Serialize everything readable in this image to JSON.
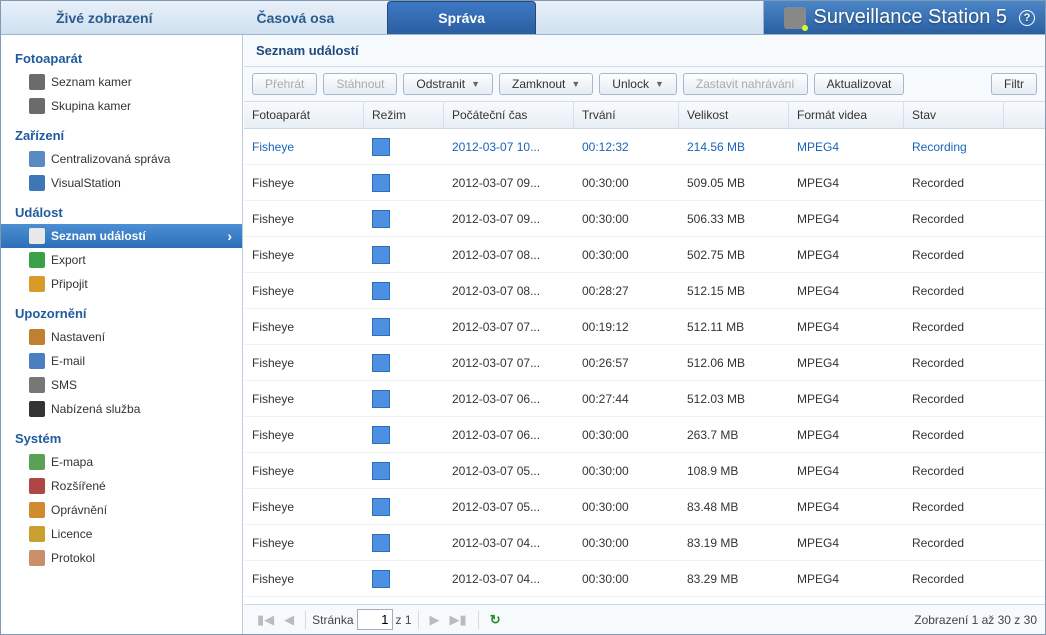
{
  "brand": {
    "title": "Surveillance Station 5"
  },
  "tabs": [
    {
      "label": "Živé zobrazení",
      "active": false
    },
    {
      "label": "Časová osa",
      "active": false
    },
    {
      "label": "Správa",
      "active": true
    }
  ],
  "sidebar": {
    "groups": [
      {
        "title": "Fotoaparát",
        "items": [
          {
            "label": "Seznam kamer",
            "icon": "#6b6b6b",
            "name": "cam-list"
          },
          {
            "label": "Skupina kamer",
            "icon": "#6b6b6b",
            "name": "cam-group"
          }
        ]
      },
      {
        "title": "Zařízení",
        "items": [
          {
            "label": "Centralizovaná správa",
            "icon": "#5a8bc0",
            "name": "central-mgmt"
          },
          {
            "label": "VisualStation",
            "icon": "#3d77b5",
            "name": "visualstation"
          }
        ]
      },
      {
        "title": "Událost",
        "items": [
          {
            "label": "Seznam událostí",
            "icon": "#e8e8e8",
            "name": "event-list",
            "active": true
          },
          {
            "label": "Export",
            "icon": "#3aa04a",
            "name": "export"
          },
          {
            "label": "Připojit",
            "icon": "#d79a2b",
            "name": "attach"
          }
        ]
      },
      {
        "title": "Upozornění",
        "items": [
          {
            "label": "Nastavení",
            "icon": "#c08030",
            "name": "notif-settings"
          },
          {
            "label": "E-mail",
            "icon": "#4a80c0",
            "name": "email"
          },
          {
            "label": "SMS",
            "icon": "#777",
            "name": "sms"
          },
          {
            "label": "Nabízená služba",
            "icon": "#333",
            "name": "push"
          }
        ]
      },
      {
        "title": "Systém",
        "items": [
          {
            "label": "E-mapa",
            "icon": "#5aa055",
            "name": "emap"
          },
          {
            "label": "Rozšířené",
            "icon": "#b04545",
            "name": "advanced"
          },
          {
            "label": "Oprávnění",
            "icon": "#d28a30",
            "name": "privilege"
          },
          {
            "label": "Licence",
            "icon": "#c9a030",
            "name": "license"
          },
          {
            "label": "Protokol",
            "icon": "#c98f6a",
            "name": "log"
          }
        ]
      }
    ]
  },
  "panel": {
    "title": "Seznam událostí"
  },
  "toolbar": {
    "play": "Přehrát",
    "download": "Stáhnout",
    "remove": "Odstranit",
    "lock": "Zamknout",
    "unlock": "Unlock",
    "stoprec": "Zastavit nahrávání",
    "update": "Aktualizovat",
    "filter": "Filtr"
  },
  "columns": {
    "camera": "Fotoaparát",
    "mode": "Režim",
    "start": "Počáteční čas",
    "duration": "Trvání",
    "size": "Velikost",
    "format": "Formát videa",
    "status": "Stav"
  },
  "rows": [
    {
      "camera": "Fisheye",
      "start": "2012-03-07 10...",
      "duration": "00:12:32",
      "size": "214.56 MB",
      "format": "MPEG4",
      "status": "Recording",
      "selected": true
    },
    {
      "camera": "Fisheye",
      "start": "2012-03-07 09...",
      "duration": "00:30:00",
      "size": "509.05 MB",
      "format": "MPEG4",
      "status": "Recorded"
    },
    {
      "camera": "Fisheye",
      "start": "2012-03-07 09...",
      "duration": "00:30:00",
      "size": "506.33 MB",
      "format": "MPEG4",
      "status": "Recorded"
    },
    {
      "camera": "Fisheye",
      "start": "2012-03-07 08...",
      "duration": "00:30:00",
      "size": "502.75 MB",
      "format": "MPEG4",
      "status": "Recorded"
    },
    {
      "camera": "Fisheye",
      "start": "2012-03-07 08...",
      "duration": "00:28:27",
      "size": "512.15 MB",
      "format": "MPEG4",
      "status": "Recorded"
    },
    {
      "camera": "Fisheye",
      "start": "2012-03-07 07...",
      "duration": "00:19:12",
      "size": "512.11 MB",
      "format": "MPEG4",
      "status": "Recorded"
    },
    {
      "camera": "Fisheye",
      "start": "2012-03-07 07...",
      "duration": "00:26:57",
      "size": "512.06 MB",
      "format": "MPEG4",
      "status": "Recorded"
    },
    {
      "camera": "Fisheye",
      "start": "2012-03-07 06...",
      "duration": "00:27:44",
      "size": "512.03 MB",
      "format": "MPEG4",
      "status": "Recorded"
    },
    {
      "camera": "Fisheye",
      "start": "2012-03-07 06...",
      "duration": "00:30:00",
      "size": "263.7 MB",
      "format": "MPEG4",
      "status": "Recorded"
    },
    {
      "camera": "Fisheye",
      "start": "2012-03-07 05...",
      "duration": "00:30:00",
      "size": "108.9 MB",
      "format": "MPEG4",
      "status": "Recorded"
    },
    {
      "camera": "Fisheye",
      "start": "2012-03-07 05...",
      "duration": "00:30:00",
      "size": "83.48 MB",
      "format": "MPEG4",
      "status": "Recorded"
    },
    {
      "camera": "Fisheye",
      "start": "2012-03-07 04...",
      "duration": "00:30:00",
      "size": "83.19 MB",
      "format": "MPEG4",
      "status": "Recorded"
    },
    {
      "camera": "Fisheye",
      "start": "2012-03-07 04...",
      "duration": "00:30:00",
      "size": "83.29 MB",
      "format": "MPEG4",
      "status": "Recorded"
    }
  ],
  "pager": {
    "page_label": "Stránka",
    "page_value": "1",
    "of_label": "z 1",
    "summary": "Zobrazení 1 až 30 z 30"
  }
}
